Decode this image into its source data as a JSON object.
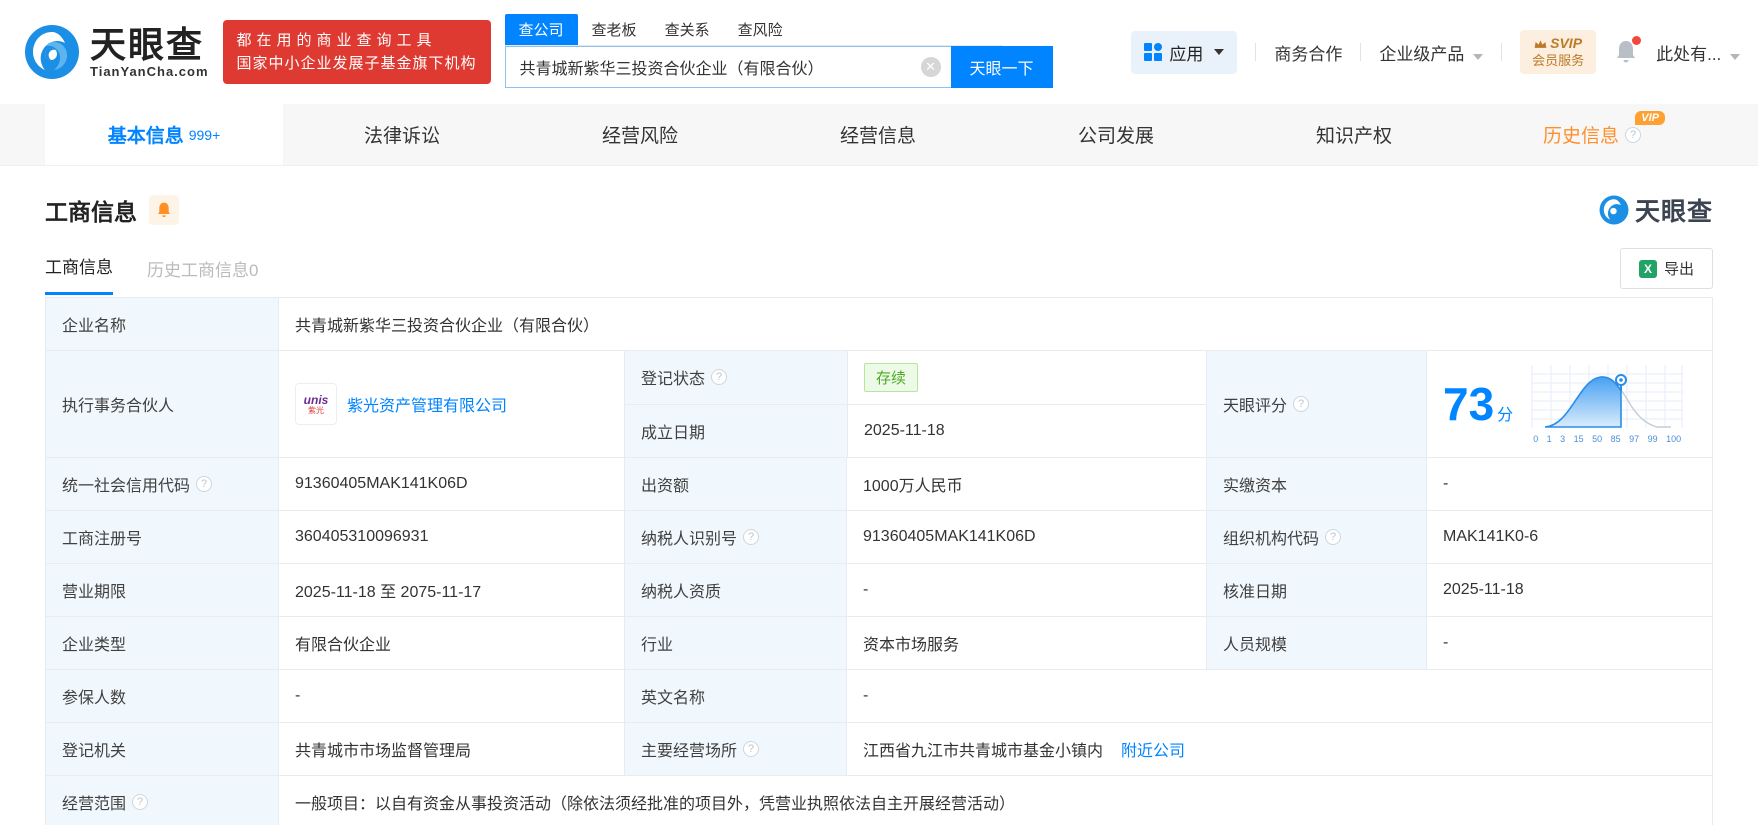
{
  "brand": {
    "name": "天眼查",
    "domain": "TianYanCha.com",
    "slogan_line1": "都在用的商业查询工具",
    "slogan_line2": "国家中小企业发展子基金旗下机构",
    "accent_color": "#0084ff",
    "banner_color": "#de3a32"
  },
  "search": {
    "tabs": {
      "0": "查公司",
      "1": "查老板",
      "2": "查关系",
      "3": "查风险"
    },
    "active_tab": "查公司",
    "value": "共青城新紫华三投资合伙企业（有限合伙）",
    "button": "天眼一下"
  },
  "header_right": {
    "apps": "应用",
    "business_coop": "商务合作",
    "enterprise_product": "企业级产品",
    "svip_line1": "SVIP",
    "svip_line2": "会员服务",
    "more": "此处有..."
  },
  "nav_tabs": {
    "0": {
      "label": "基本信息",
      "count": "999+"
    },
    "1": {
      "label": "法律诉讼"
    },
    "2": {
      "label": "经营风险"
    },
    "3": {
      "label": "经营信息"
    },
    "4": {
      "label": "公司发展"
    },
    "5": {
      "label": "知识产权"
    },
    "6": {
      "label": "历史信息",
      "vip": "VIP"
    }
  },
  "section": {
    "title": "工商信息",
    "watermark": "天眼查",
    "subtab_active": "工商信息",
    "subtab_history": "历史工商信息0",
    "export_label": "导出"
  },
  "table": {
    "company_name": {
      "label": "企业名称",
      "value": "共青城新紫华三投资合伙企业（有限合伙）"
    },
    "partner": {
      "label": "执行事务合伙人",
      "logo_line1": "unis",
      "logo_line2": "紫光",
      "link": "紫光资产管理有限公司"
    },
    "reg_status": {
      "label": "登记状态",
      "value": "存续"
    },
    "establish_date": {
      "label": "成立日期",
      "value": "2025-11-18"
    },
    "score": {
      "label": "天眼评分",
      "value": "73",
      "unit": "分",
      "axis": {
        "0": "0",
        "1": "1",
        "2": "3",
        "3": "15",
        "4": "50",
        "5": "85",
        "6": "97",
        "7": "99",
        "8": "100"
      }
    },
    "credit_code": {
      "label": "统一社会信用代码",
      "value": "91360405MAK141K06D"
    },
    "capital": {
      "label": "出资额",
      "value": "1000万人民币"
    },
    "paid_capital": {
      "label": "实缴资本",
      "value": "-"
    },
    "reg_number": {
      "label": "工商注册号",
      "value": "360405310096931"
    },
    "taxpayer_id": {
      "label": "纳税人识别号",
      "value": "91360405MAK141K06D"
    },
    "org_code": {
      "label": "组织机构代码",
      "value": "MAK141K0-6"
    },
    "business_term": {
      "label": "营业期限",
      "value": "2025-11-18 至 2075-11-17"
    },
    "taxpayer_quality": {
      "label": "纳税人资质",
      "value": "-"
    },
    "approval_date": {
      "label": "核准日期",
      "value": "2025-11-18"
    },
    "company_type": {
      "label": "企业类型",
      "value": "有限合伙企业"
    },
    "industry": {
      "label": "行业",
      "value": "资本市场服务"
    },
    "staff_size": {
      "label": "人员规模",
      "value": "-"
    },
    "insured_count": {
      "label": "参保人数",
      "value": "-"
    },
    "english_name": {
      "label": "英文名称",
      "value": "-"
    },
    "reg_authority": {
      "label": "登记机关",
      "value": "共青城市市场监督管理局"
    },
    "business_address": {
      "label": "主要经营场所",
      "value": "江西省九江市共青城市基金小镇内",
      "nearby_link": "附近公司"
    },
    "business_scope": {
      "label": "经营范围",
      "value": "一般项目：以自有资金从事投资活动（除依法须经批准的项目外，凭营业执照依法自主开展经营活动）"
    }
  }
}
